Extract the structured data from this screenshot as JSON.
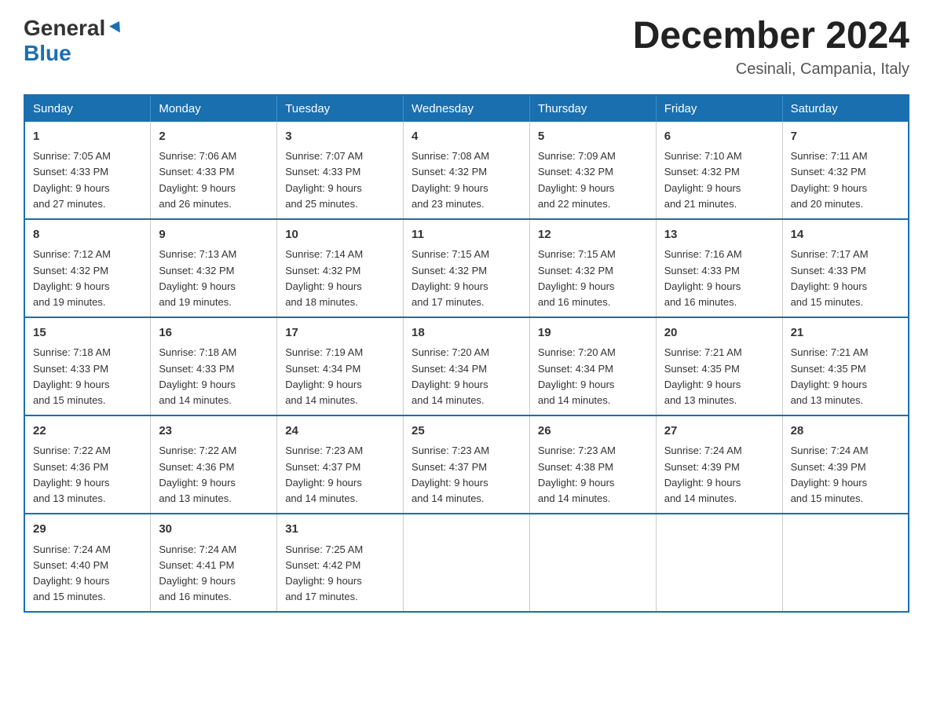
{
  "logo": {
    "general": "General",
    "blue": "Blue"
  },
  "header": {
    "month": "December 2024",
    "location": "Cesinali, Campania, Italy"
  },
  "days_of_week": [
    "Sunday",
    "Monday",
    "Tuesday",
    "Wednesday",
    "Thursday",
    "Friday",
    "Saturday"
  ],
  "weeks": [
    [
      {
        "day": "1",
        "sunrise": "7:05 AM",
        "sunset": "4:33 PM",
        "daylight": "9 hours and 27 minutes."
      },
      {
        "day": "2",
        "sunrise": "7:06 AM",
        "sunset": "4:33 PM",
        "daylight": "9 hours and 26 minutes."
      },
      {
        "day": "3",
        "sunrise": "7:07 AM",
        "sunset": "4:33 PM",
        "daylight": "9 hours and 25 minutes."
      },
      {
        "day": "4",
        "sunrise": "7:08 AM",
        "sunset": "4:32 PM",
        "daylight": "9 hours and 23 minutes."
      },
      {
        "day": "5",
        "sunrise": "7:09 AM",
        "sunset": "4:32 PM",
        "daylight": "9 hours and 22 minutes."
      },
      {
        "day": "6",
        "sunrise": "7:10 AM",
        "sunset": "4:32 PM",
        "daylight": "9 hours and 21 minutes."
      },
      {
        "day": "7",
        "sunrise": "7:11 AM",
        "sunset": "4:32 PM",
        "daylight": "9 hours and 20 minutes."
      }
    ],
    [
      {
        "day": "8",
        "sunrise": "7:12 AM",
        "sunset": "4:32 PM",
        "daylight": "9 hours and 19 minutes."
      },
      {
        "day": "9",
        "sunrise": "7:13 AM",
        "sunset": "4:32 PM",
        "daylight": "9 hours and 19 minutes."
      },
      {
        "day": "10",
        "sunrise": "7:14 AM",
        "sunset": "4:32 PM",
        "daylight": "9 hours and 18 minutes."
      },
      {
        "day": "11",
        "sunrise": "7:15 AM",
        "sunset": "4:32 PM",
        "daylight": "9 hours and 17 minutes."
      },
      {
        "day": "12",
        "sunrise": "7:15 AM",
        "sunset": "4:32 PM",
        "daylight": "9 hours and 16 minutes."
      },
      {
        "day": "13",
        "sunrise": "7:16 AM",
        "sunset": "4:33 PM",
        "daylight": "9 hours and 16 minutes."
      },
      {
        "day": "14",
        "sunrise": "7:17 AM",
        "sunset": "4:33 PM",
        "daylight": "9 hours and 15 minutes."
      }
    ],
    [
      {
        "day": "15",
        "sunrise": "7:18 AM",
        "sunset": "4:33 PM",
        "daylight": "9 hours and 15 minutes."
      },
      {
        "day": "16",
        "sunrise": "7:18 AM",
        "sunset": "4:33 PM",
        "daylight": "9 hours and 14 minutes."
      },
      {
        "day": "17",
        "sunrise": "7:19 AM",
        "sunset": "4:34 PM",
        "daylight": "9 hours and 14 minutes."
      },
      {
        "day": "18",
        "sunrise": "7:20 AM",
        "sunset": "4:34 PM",
        "daylight": "9 hours and 14 minutes."
      },
      {
        "day": "19",
        "sunrise": "7:20 AM",
        "sunset": "4:34 PM",
        "daylight": "9 hours and 14 minutes."
      },
      {
        "day": "20",
        "sunrise": "7:21 AM",
        "sunset": "4:35 PM",
        "daylight": "9 hours and 13 minutes."
      },
      {
        "day": "21",
        "sunrise": "7:21 AM",
        "sunset": "4:35 PM",
        "daylight": "9 hours and 13 minutes."
      }
    ],
    [
      {
        "day": "22",
        "sunrise": "7:22 AM",
        "sunset": "4:36 PM",
        "daylight": "9 hours and 13 minutes."
      },
      {
        "day": "23",
        "sunrise": "7:22 AM",
        "sunset": "4:36 PM",
        "daylight": "9 hours and 13 minutes."
      },
      {
        "day": "24",
        "sunrise": "7:23 AM",
        "sunset": "4:37 PM",
        "daylight": "9 hours and 14 minutes."
      },
      {
        "day": "25",
        "sunrise": "7:23 AM",
        "sunset": "4:37 PM",
        "daylight": "9 hours and 14 minutes."
      },
      {
        "day": "26",
        "sunrise": "7:23 AM",
        "sunset": "4:38 PM",
        "daylight": "9 hours and 14 minutes."
      },
      {
        "day": "27",
        "sunrise": "7:24 AM",
        "sunset": "4:39 PM",
        "daylight": "9 hours and 14 minutes."
      },
      {
        "day": "28",
        "sunrise": "7:24 AM",
        "sunset": "4:39 PM",
        "daylight": "9 hours and 15 minutes."
      }
    ],
    [
      {
        "day": "29",
        "sunrise": "7:24 AM",
        "sunset": "4:40 PM",
        "daylight": "9 hours and 15 minutes."
      },
      {
        "day": "30",
        "sunrise": "7:24 AM",
        "sunset": "4:41 PM",
        "daylight": "9 hours and 16 minutes."
      },
      {
        "day": "31",
        "sunrise": "7:25 AM",
        "sunset": "4:42 PM",
        "daylight": "9 hours and 17 minutes."
      },
      null,
      null,
      null,
      null
    ]
  ],
  "labels": {
    "sunrise": "Sunrise:",
    "sunset": "Sunset:",
    "daylight": "Daylight: 9 hours"
  }
}
